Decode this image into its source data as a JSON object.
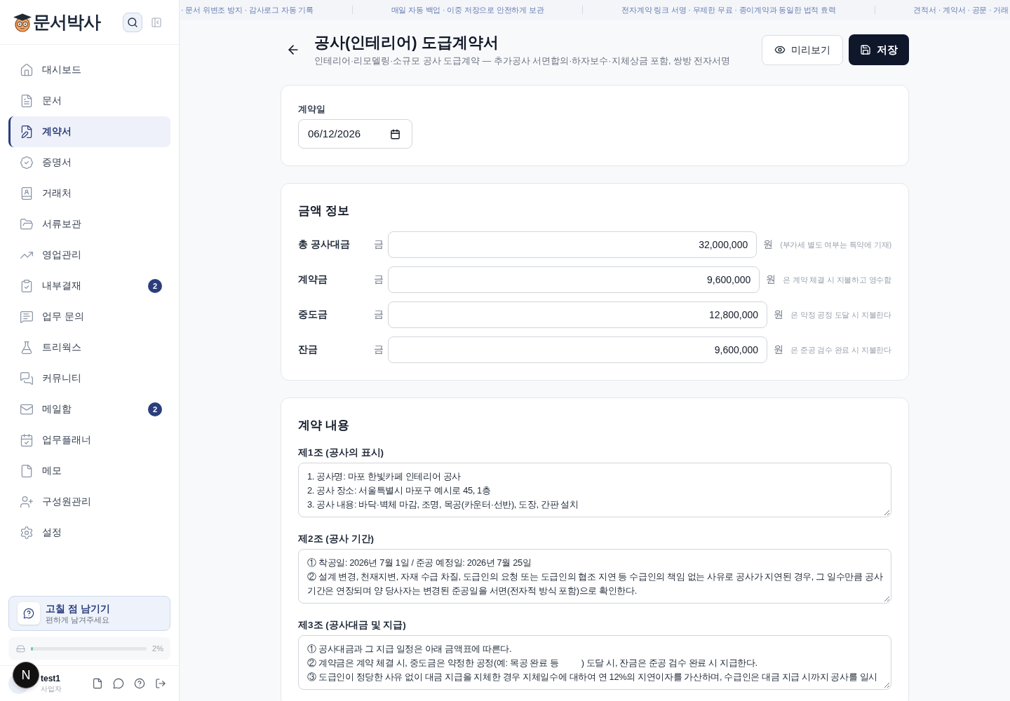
{
  "sidebar": {
    "logo": {
      "text": "문서박사"
    },
    "nav_items": [
      {
        "label": "대시보드",
        "selected": false
      },
      {
        "label": "문서",
        "selected": false
      },
      {
        "label": "계약서",
        "selected": true
      },
      {
        "label": "증명서",
        "selected": false
      },
      {
        "label": "거래처",
        "selected": false
      },
      {
        "label": "서류보관",
        "selected": false
      },
      {
        "label": "영업관리",
        "selected": false
      },
      {
        "label": "내부결재",
        "selected": false,
        "badge": "2"
      },
      {
        "label": "업무 문의",
        "selected": false
      },
      {
        "label": "트리웍스",
        "selected": false
      },
      {
        "label": "커뮤니티",
        "selected": false
      },
      {
        "label": "메일함",
        "selected": false,
        "badge": "2"
      },
      {
        "label": "업무플래너",
        "selected": false
      },
      {
        "label": "메모",
        "selected": false
      },
      {
        "label": "구성원관리",
        "selected": false
      },
      {
        "label": "설정",
        "selected": false
      }
    ],
    "feedback": {
      "title": "고칠 점 남기기",
      "subtitle": "편하게 남겨주세요"
    },
    "storage": {
      "level": 0.02,
      "reading": "2%"
    },
    "user": {
      "name": "test1",
      "role": "사업자"
    }
  },
  "dev_badge": {
    "label": "N"
  },
  "ticker": [
    "· 문서 위변조 방지 · 감사로그 자동 기록",
    "매일 자동 백업 · 이중 저장으로 안전하게 보관",
    "전자계약 링크 서명 · 무제한 무료 · 종이계약과 동일한 법적 효력",
    "견적서 · 계약서 · 공문 · 거래"
  ],
  "header": {
    "title": "공사(인테리어) 도급계약서",
    "subtitle": "인테리어·리모델링·소규모 공사 도급계약 — 추가공사 서면합의·하자보수·지체상금 포함, 쌍방 전자서명",
    "buttons": [
      {
        "label": "미리보기",
        "kind": "outline"
      },
      {
        "label": "저장",
        "kind": "primary"
      }
    ]
  },
  "contract_date": {
    "label": "계약일",
    "value": "06/12/2026"
  },
  "amounts": {
    "title": "금액 정보",
    "rows": [
      {
        "label": "총 공사대금",
        "prefix": "금",
        "value": "32,000,000",
        "unit": "원",
        "note": "(부가세 별도 여부는 특약에 기재)"
      },
      {
        "label": "계약금",
        "prefix": "금",
        "value": "9,600,000",
        "unit": "원",
        "note": "은 계약 체결 시 지불하고 영수함"
      },
      {
        "label": "중도금",
        "prefix": "금",
        "value": "12,800,000",
        "unit": "원",
        "note": "은 약정 공정 도달 시 지불한다"
      },
      {
        "label": "잔금",
        "prefix": "금",
        "value": "9,600,000",
        "unit": "원",
        "note": "은 준공 검수 완료 시 지불한다"
      }
    ]
  },
  "contents": {
    "title": "계약 내용",
    "articles": [
      {
        "label": "제1조 (공사의 표시)",
        "text": "1. 공사명: 마포 한빛카페 인테리어 공사\n2. 공사 장소: 서울특별시 마포구 예시로 45, 1층\n3. 공사 내용: 바닥·벽체 마감, 조명, 목공(카운터·선반), 도장, 간판 설치"
      },
      {
        "label": "제2조 (공사 기간)",
        "text": "① 착공일: 2026년 7월 1일 / 준공 예정일: 2026년 7월 25일\n② 설계 변경, 천재지변, 자재 수급 차질, 도급인의 요청 또는 도급인의 협조 지연 등 수급인의 책임 없는 사유로 공사가 지연된 경우, 그 일수만큼 공사 기간은 연장되며 양 당사자는 변경된 준공일을 서면(전자적 방식 포함)으로 확인한다."
      },
      {
        "label": "제3조 (공사대금 및 지급)",
        "text": "① 공사대금과 그 지급 일정은 아래 금액표에 따른다.\n② 계약금은 계약 체결 시, 중도금은 약정한 공정(예: 목공 완료 등          ) 도달 시, 잔금은 준공 검수 완료 시 지급한다.\n③ 도급인이 정당한 사유 없이 대금 지급을 지체한 경우 지체일수에 대하여 연 12%의 지연이자를 가산하며, 수급인은 대금 지급 시까지 공사를 일시"
      }
    ]
  }
}
